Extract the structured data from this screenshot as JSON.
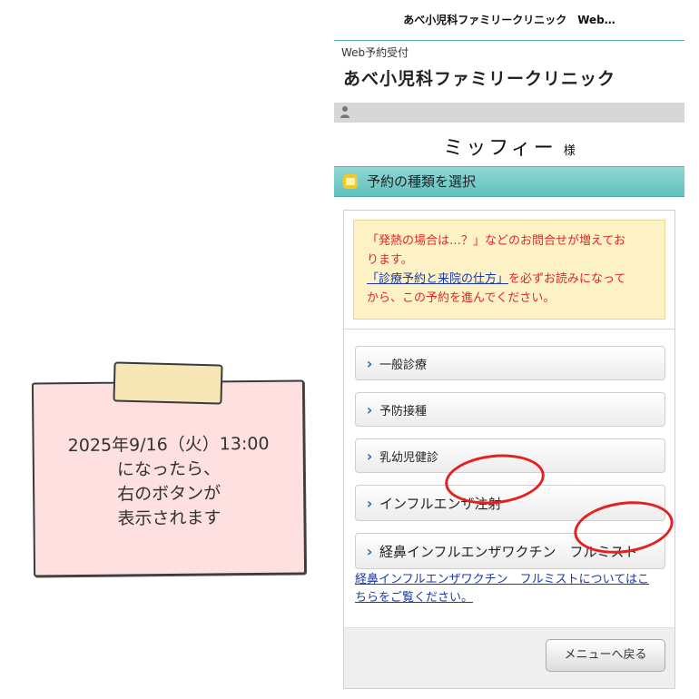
{
  "note": {
    "line1": "2025年9/16（火）13:00",
    "line2": "になったら、",
    "line3": "右のボタンが",
    "line4": "表示されます"
  },
  "screen": {
    "topbar_title": "あべ小児科ファミリークリニック　Web…",
    "web_label": "Web予約受付",
    "clinic_title": "あべ小児科ファミリークリニック",
    "user_name": "ミッフィー",
    "user_suffix": "様",
    "section_title": "予約の種類を選択",
    "notice": {
      "line1": "「発熱の場合は…？」などのお問合せが増えてお",
      "line2": "ります。",
      "link": "「診療予約と来院の仕方」",
      "line3_rest": "を必ずお読みになって",
      "line4": "から、この予約を進んでください。"
    },
    "options": [
      {
        "label": "一般診療"
      },
      {
        "label": "予防接種"
      },
      {
        "label": "乳幼児健診"
      },
      {
        "label": "インフルエンザ注射"
      },
      {
        "label": "経鼻インフルエンザワクチン　フルミスト"
      }
    ],
    "info_link_line1": "経鼻インフルエンザワクチン　フルミストについてはこ",
    "info_link_line2": "ちらをご覧ください。",
    "back_button": "メニューへ戻る"
  },
  "colors": {
    "accent_teal": "#62c1be",
    "notice_red": "#e0262a",
    "link_blue": "#1a3aa8",
    "highlight_circle": "#e5211f",
    "note_pink": "#fde0df"
  }
}
